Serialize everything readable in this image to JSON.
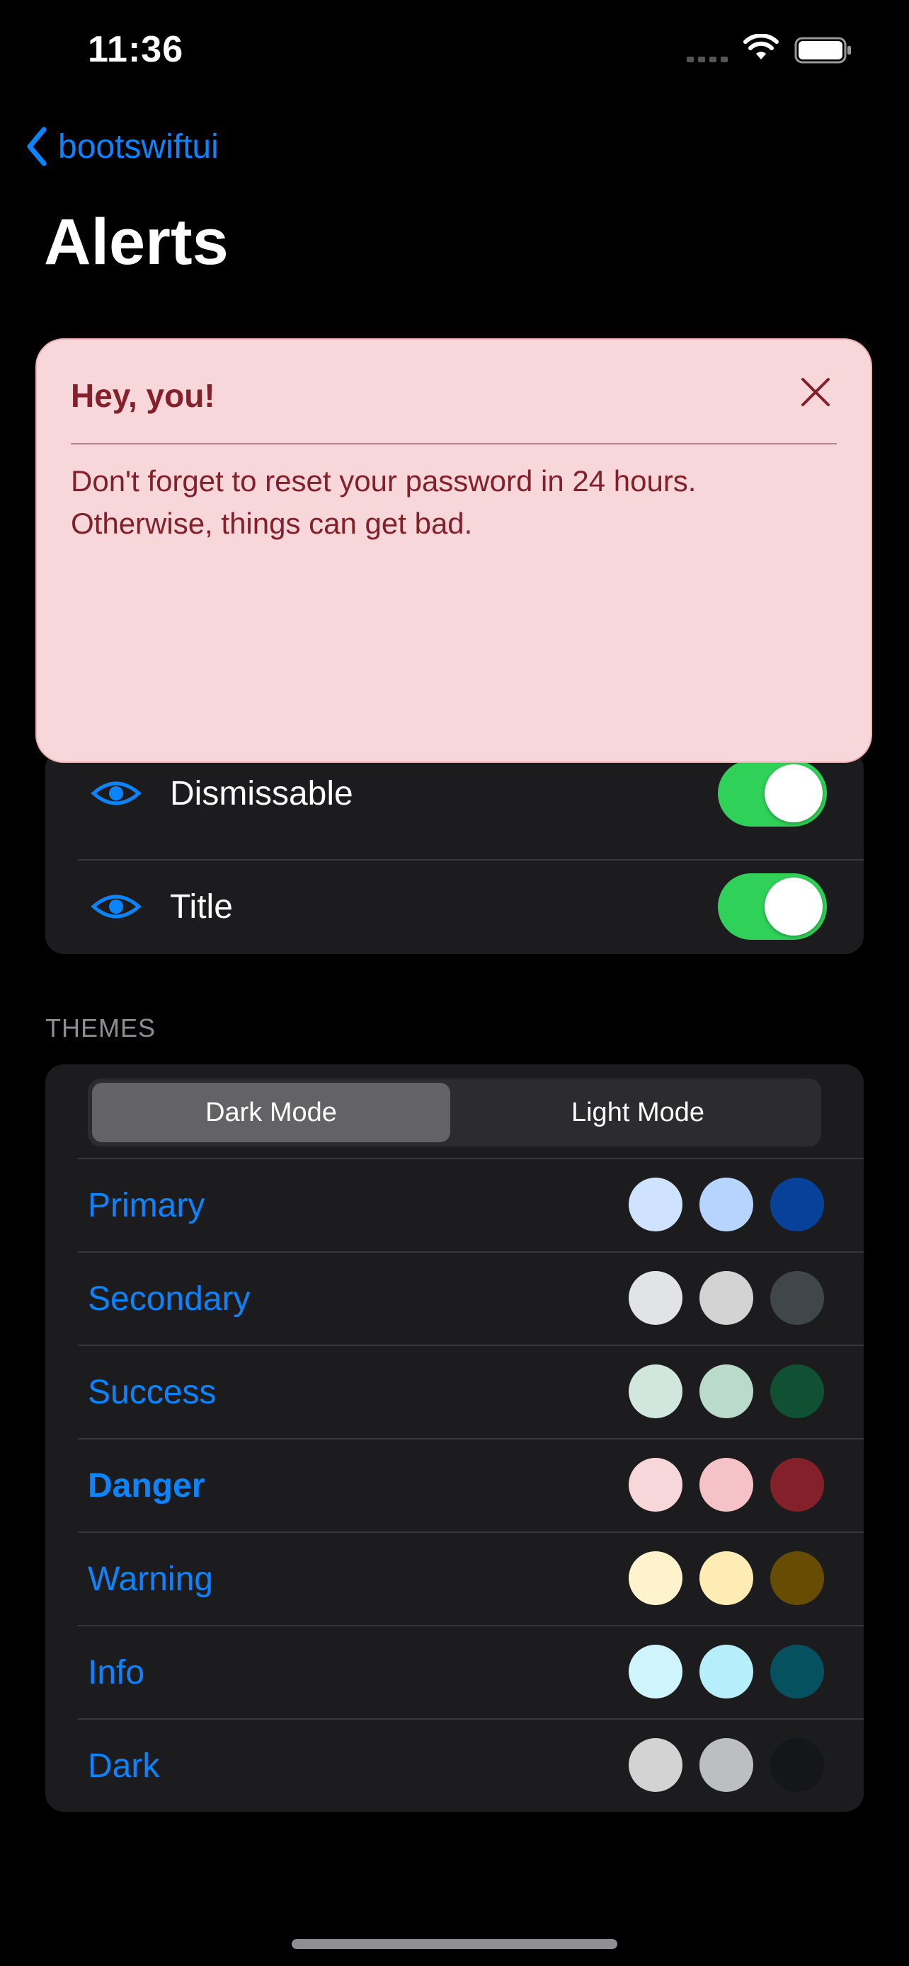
{
  "status_bar": {
    "time": "11:36",
    "signal_icon": "cellular-signal-icon",
    "wifi_icon": "wifi-icon",
    "battery_icon": "battery-full-icon"
  },
  "nav": {
    "back_label": "bootswiftui",
    "back_icon": "chevron-left-icon",
    "title": "Alerts"
  },
  "alert": {
    "title": "Hey, you!",
    "body": "Don't forget to reset your password in 24 hours. Otherwise, things can get bad.",
    "close_icon": "close-icon",
    "background": "#f8d7da",
    "text_color": "#842029"
  },
  "settings": {
    "rows": [
      {
        "label": "Dismissable",
        "icon": "eye-icon",
        "on": true
      },
      {
        "label": "Title",
        "icon": "eye-icon",
        "on": true
      }
    ]
  },
  "themes": {
    "section_header": "THEMES",
    "modes": [
      {
        "label": "Dark Mode",
        "selected": true
      },
      {
        "label": "Light Mode",
        "selected": false
      }
    ],
    "items": [
      {
        "label": "Primary",
        "selected": false,
        "colors": [
          "#cfe2ff",
          "#b6d4fe",
          "#084298"
        ]
      },
      {
        "label": "Secondary",
        "selected": false,
        "colors": [
          "#e2e3e5",
          "#d3d3d4",
          "#41464b"
        ]
      },
      {
        "label": "Success",
        "selected": false,
        "colors": [
          "#d1e7dd",
          "#badbcc",
          "#0f5132"
        ]
      },
      {
        "label": "Danger",
        "selected": true,
        "colors": [
          "#f8d7da",
          "#f5c2c7",
          "#842029"
        ]
      },
      {
        "label": "Warning",
        "selected": false,
        "colors": [
          "#fff3cd",
          "#ffecb5",
          "#664d03"
        ]
      },
      {
        "label": "Info",
        "selected": false,
        "colors": [
          "#cff4fc",
          "#b6effb",
          "#055160"
        ]
      },
      {
        "label": "Dark",
        "selected": false,
        "colors": [
          "#d3d3d4",
          "#bcbebf",
          "#141619"
        ]
      }
    ]
  }
}
